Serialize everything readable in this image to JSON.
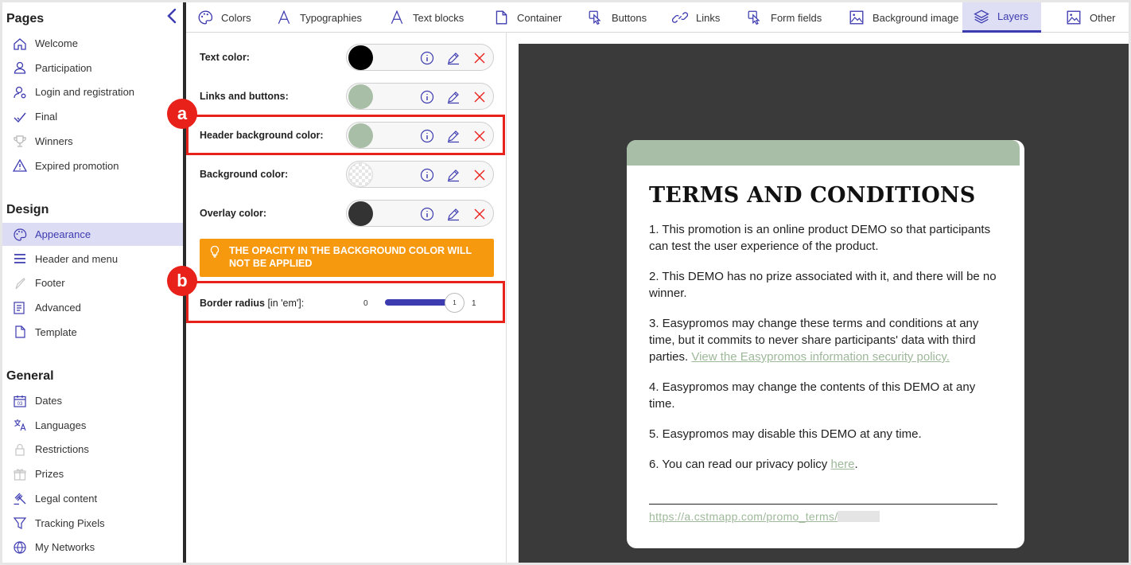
{
  "sidebar": {
    "pages_title": "Pages",
    "pages": [
      {
        "label": "Welcome",
        "icon": "home-icon"
      },
      {
        "label": "Participation",
        "icon": "user-icon"
      },
      {
        "label": "Login and registration",
        "icon": "user-gear-icon"
      },
      {
        "label": "Final",
        "icon": "check-icon"
      },
      {
        "label": "Winners",
        "icon": "trophy-icon"
      },
      {
        "label": "Expired promotion",
        "icon": "warning-icon"
      }
    ],
    "design_title": "Design",
    "design": [
      {
        "label": "Appearance",
        "icon": "palette-icon",
        "active": true
      },
      {
        "label": "Header and menu",
        "icon": "menu-icon"
      },
      {
        "label": "Footer",
        "icon": "footer-icon"
      },
      {
        "label": "Advanced",
        "icon": "code-icon"
      },
      {
        "label": "Template",
        "icon": "file-icon"
      }
    ],
    "general_title": "General",
    "general": [
      {
        "label": "Dates",
        "icon": "calendar-icon",
        "icon_text": "03"
      },
      {
        "label": "Languages",
        "icon": "translate-icon"
      },
      {
        "label": "Restrictions",
        "icon": "lock-icon"
      },
      {
        "label": "Prizes",
        "icon": "gift-icon"
      },
      {
        "label": "Legal content",
        "icon": "gavel-icon"
      },
      {
        "label": "Tracking Pixels",
        "icon": "filter-icon"
      },
      {
        "label": "My Networks",
        "icon": "globe-icon"
      }
    ]
  },
  "tabs": [
    {
      "label": "Colors",
      "icon": "palette-icon"
    },
    {
      "label": "Typographies",
      "icon": "typography-icon"
    },
    {
      "label": "Text blocks",
      "icon": "typography-icon"
    },
    {
      "label": "Container",
      "icon": "file-icon"
    },
    {
      "label": "Buttons",
      "icon": "pointer-icon"
    },
    {
      "label": "Links",
      "icon": "link-icon"
    },
    {
      "label": "Form fields",
      "icon": "pointer-icon"
    },
    {
      "label": "Background image",
      "icon": "image-icon"
    },
    {
      "label": "Layers",
      "icon": "layers-icon",
      "active": true
    },
    {
      "label": "Other",
      "icon": "image-icon"
    }
  ],
  "settings": {
    "colors": [
      {
        "label": "Text color:",
        "color": "#000000"
      },
      {
        "label": "Links and buttons:",
        "color": "#a9bea6"
      },
      {
        "label": "Header background color:",
        "color": "#a9bea6"
      },
      {
        "label": "Background color:",
        "color": "transparent"
      },
      {
        "label": "Overlay color:",
        "color": "#333333"
      }
    ],
    "warning": "THE OPACITY IN THE BACKGROUND COLOR WILL NOT BE APPLIED",
    "border_radius": {
      "label": "Border radius",
      "unit": "[in 'em']:",
      "min": "0",
      "max": "1",
      "value": "1"
    },
    "annotations": {
      "a": "a",
      "b": "b"
    }
  },
  "preview": {
    "title": "TERMS AND CONDITIONS",
    "terms": [
      {
        "text": "1. This promotion is an online product DEMO so that participants can test the user experience of the product."
      },
      {
        "text": "2. This DEMO has no prize associated with it, and there will be no winner."
      },
      {
        "text": "3. Easypromos may change these terms and conditions at any time, but it commits to never share participants' data with third parties. ",
        "link": "View the Easypromos information security policy."
      },
      {
        "text": "4. Easypromos may change the contents of this DEMO at any time."
      },
      {
        "text": "5. Easypromos may disable this DEMO at any time."
      },
      {
        "text": "6. You can read our privacy policy ",
        "link": "here",
        "after": "."
      }
    ],
    "url": "https://a.cstmapp.com/promo_terms/"
  },
  "colors": {
    "accent": "#3d3bb0",
    "highlight": "#e8211b",
    "warning": "#f6990f",
    "header_green": "#a9bea6",
    "preview_bg": "#3a3a3a"
  }
}
